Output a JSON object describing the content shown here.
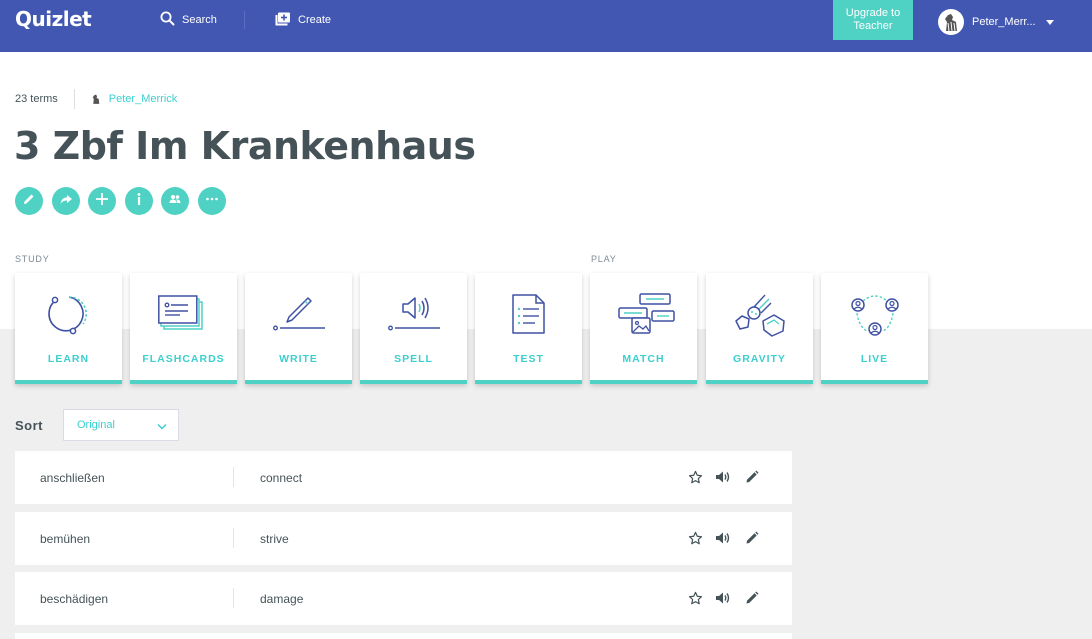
{
  "nav": {
    "logo": "Quizlet",
    "search_label": "Search",
    "create_label": "Create",
    "upgrade_line1": "Upgrade to",
    "upgrade_line2": "Teacher",
    "username": "Peter_Merr..."
  },
  "set": {
    "term_count": "23 terms",
    "author": "Peter_Merrick",
    "title": "3 Zbf Im Krankenhaus",
    "actions": [
      "edit-icon",
      "share-icon",
      "add-icon",
      "info-icon",
      "class-icon",
      "more-icon"
    ]
  },
  "sections": {
    "study": "STUDY",
    "play": "PLAY"
  },
  "modes": [
    {
      "label": "LEARN",
      "icon": "learn-icon"
    },
    {
      "label": "FLASHCARDS",
      "icon": "flashcards-icon"
    },
    {
      "label": "WRITE",
      "icon": "write-icon"
    },
    {
      "label": "SPELL",
      "icon": "spell-icon"
    },
    {
      "label": "TEST",
      "icon": "test-icon"
    },
    {
      "label": "MATCH",
      "icon": "match-icon"
    },
    {
      "label": "GRAVITY",
      "icon": "gravity-icon"
    },
    {
      "label": "LIVE",
      "icon": "live-icon"
    }
  ],
  "sort": {
    "label": "Sort",
    "selected": "Original"
  },
  "terms": [
    {
      "term": "anschließen",
      "definition": "connect"
    },
    {
      "term": "bemühen",
      "definition": "strive"
    },
    {
      "term": "beschädigen",
      "definition": "damage"
    }
  ],
  "colors": {
    "nav_bg": "#4257b2",
    "accent": "#4fd1c4",
    "text": "#455358",
    "icon_navy": "#3f51a3"
  }
}
